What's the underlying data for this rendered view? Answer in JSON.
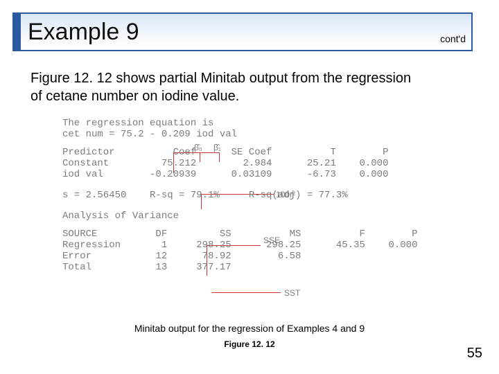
{
  "title": "Example 9",
  "contd": "cont'd",
  "body_text": "Figure 12. 12 shows partial Minitab output from the regression of cetane number on iodine value.",
  "output": {
    "l1": "The regression equation is",
    "l2": "cet num = 75.2 - 0.209 iod val",
    "hdr": "Predictor          Coef      SE Coef          T        P",
    "row_const": "Constant         75.212        2.984      25.21    0.000",
    "row_iod": "iod val        -0.20939      0.03109      -6.73    0.000",
    "stats": "s = 2.56450    R-sq = 79.1%     R-sq(adj) = 77.3%",
    "av": "Analysis of Variance",
    "av_hdr": "SOURCE          DF         SS          MS          F        P",
    "av_reg": "Regression       1     298.25      298.25      45.35    0.000",
    "av_err": "Error           12      78.92        6.58",
    "av_tot": "Total           13     377.17"
  },
  "annotations": {
    "beta0": "β̂₀",
    "beta1": "β̂₁",
    "r2": "100r²",
    "sse": "SSE",
    "sst": "SST"
  },
  "caption1": "Minitab output for the regression of Examples 4 and 9",
  "caption2": "Figure 12. 12",
  "page_number": "55",
  "chart_data": {
    "type": "table",
    "title": "Minitab regression output: cetane number on iodine value",
    "equation": "cet num = 75.2 - 0.209 iod val",
    "coefficients": [
      {
        "predictor": "Constant",
        "coef": 75.212,
        "se_coef": 2.984,
        "t": 25.21,
        "p": 0.0
      },
      {
        "predictor": "iod val",
        "coef": -0.20939,
        "se_coef": 0.03109,
        "t": -6.73,
        "p": 0.0
      }
    ],
    "s": 2.5645,
    "r_sq_pct": 79.1,
    "r_sq_adj_pct": 77.3,
    "anova": [
      {
        "source": "Regression",
        "df": 1,
        "ss": 298.25,
        "ms": 298.25,
        "f": 45.35,
        "p": 0.0
      },
      {
        "source": "Error",
        "df": 12,
        "ss": 78.92,
        "ms": 6.58
      },
      {
        "source": "Total",
        "df": 13,
        "ss": 377.17
      }
    ]
  }
}
